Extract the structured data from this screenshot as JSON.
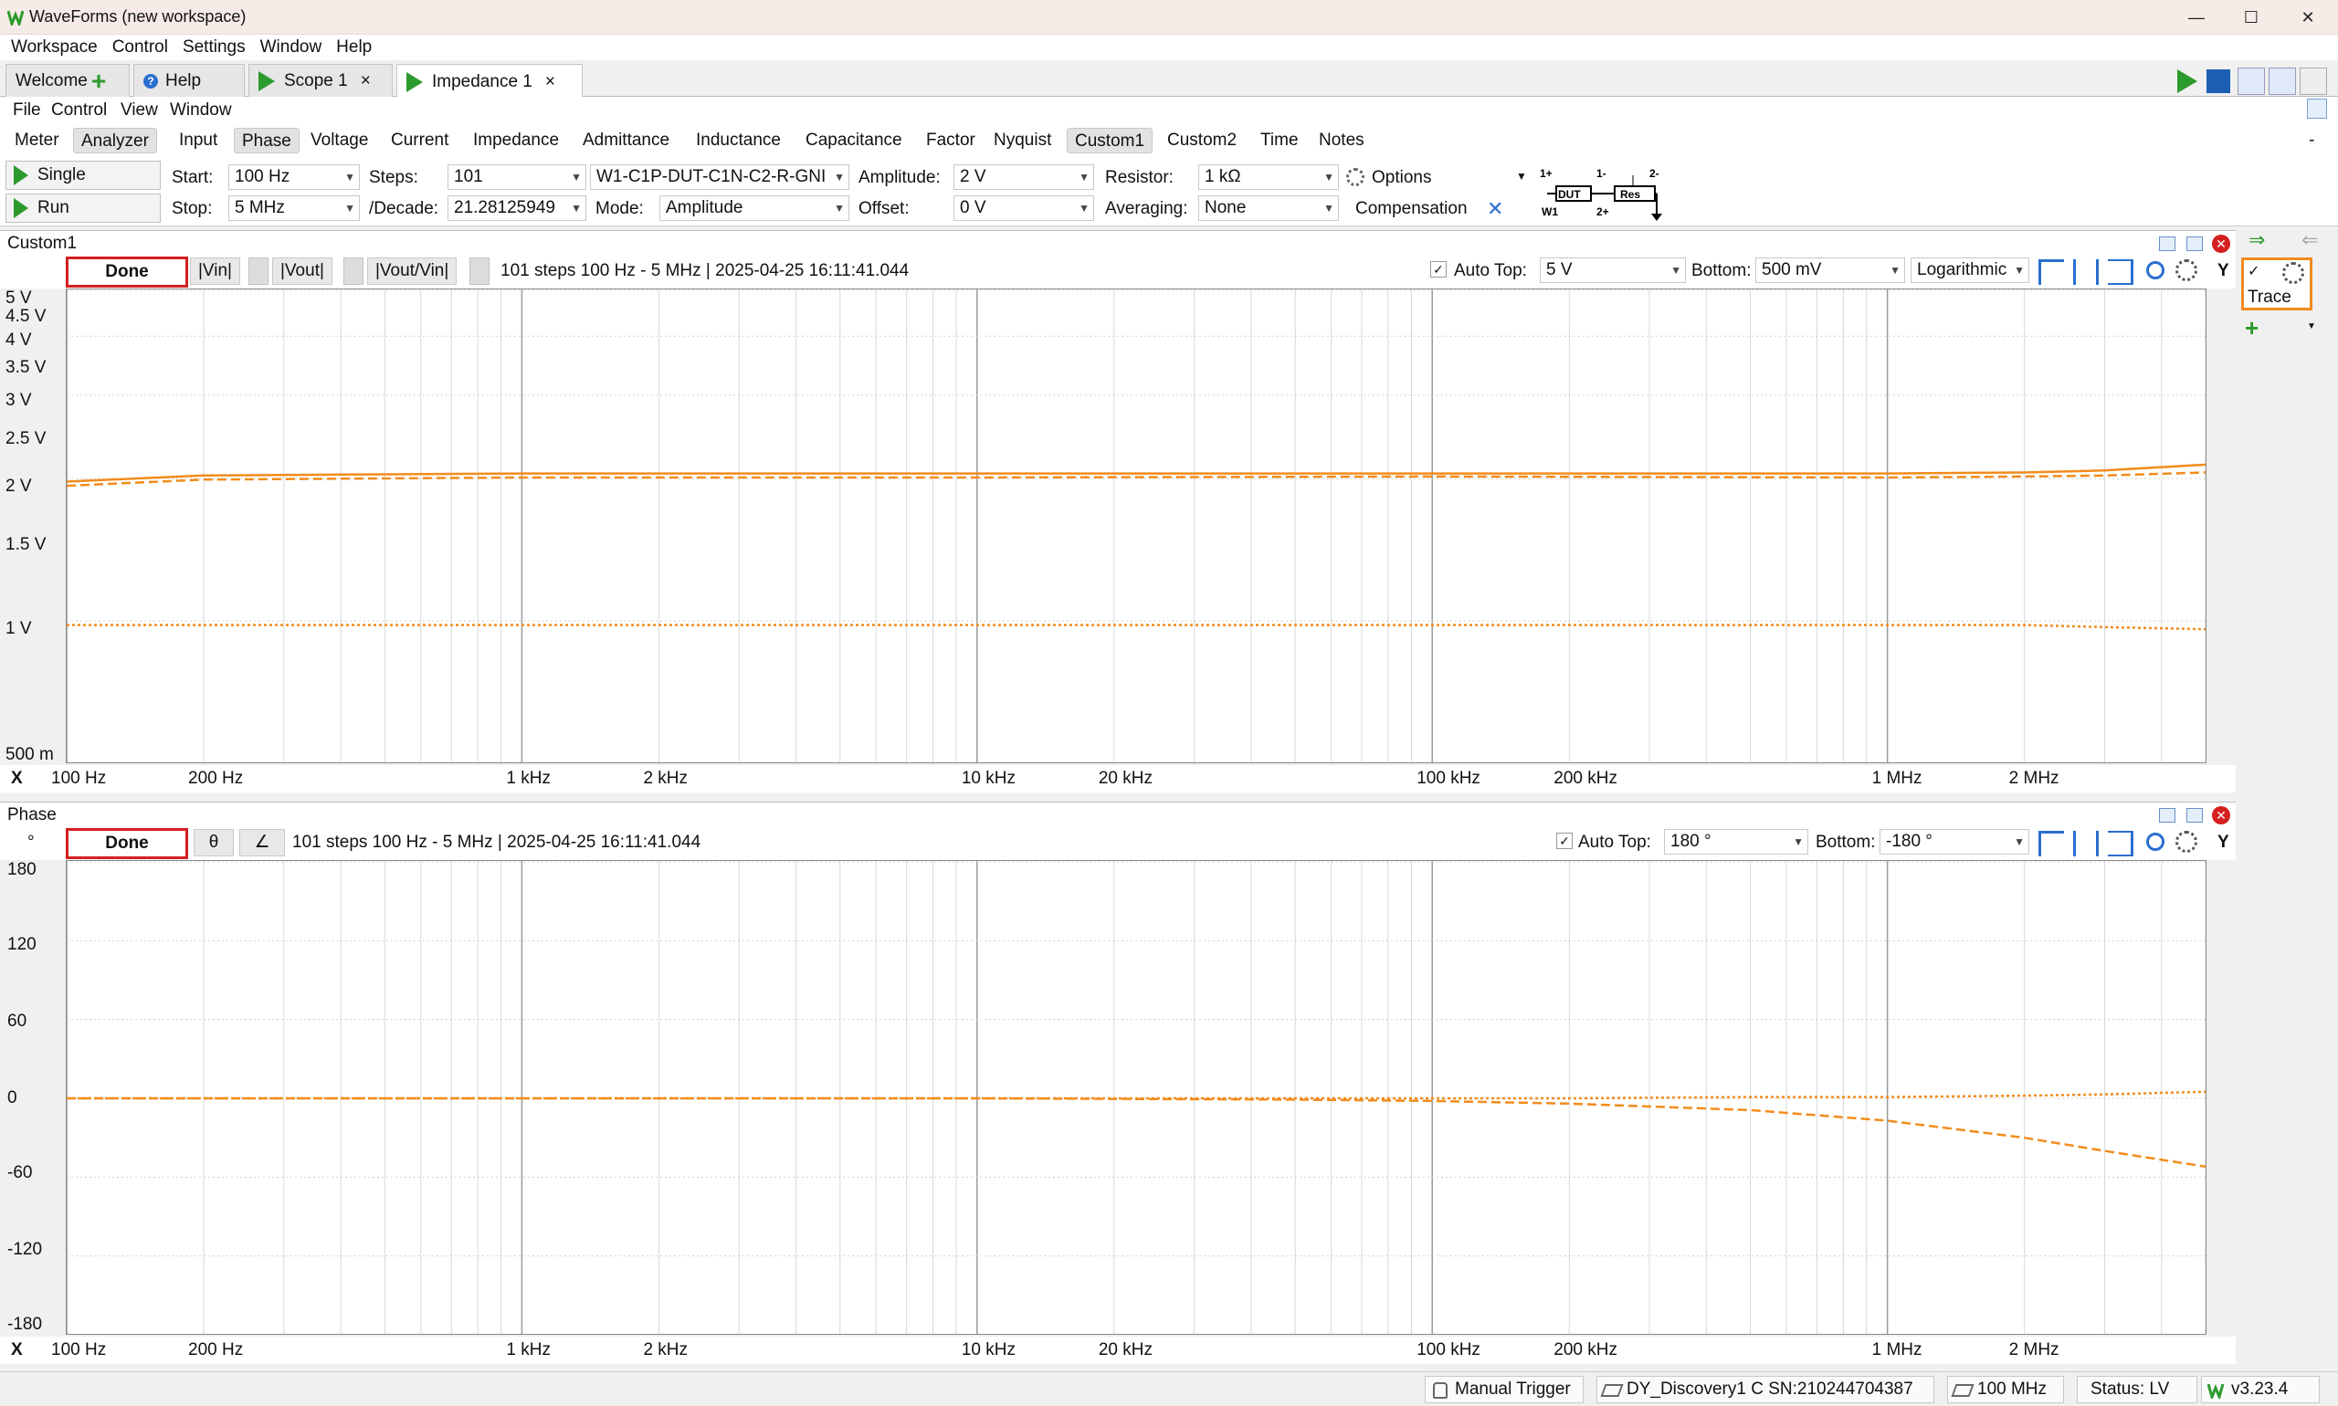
{
  "window": {
    "title": "WaveForms (new workspace)",
    "minimize": "—",
    "maximize": "☐",
    "close": "✕"
  },
  "menubar": [
    "Workspace",
    "Control",
    "Settings",
    "Window",
    "Help"
  ],
  "tabs": {
    "welcome": "Welcome",
    "help": "Help",
    "scope": "Scope 1",
    "impedance": "Impedance 1",
    "close": "×"
  },
  "submenu": [
    "File",
    "Control",
    "View",
    "Window"
  ],
  "viewtabs": [
    "Meter",
    "Analyzer",
    "Input",
    "Phase",
    "Voltage",
    "Current",
    "Impedance",
    "Admittance",
    "Inductance",
    "Capacitance",
    "Factor",
    "Nyquist",
    "Custom1",
    "Custom2",
    "Time",
    "Notes"
  ],
  "viewtabs_right": "-",
  "controls": {
    "single": "Single",
    "run": "Run",
    "start_label": "Start:",
    "start_value": "100 Hz",
    "stop_label": "Stop:",
    "stop_value": "5 MHz",
    "steps_label": "Steps:",
    "steps_value": "101",
    "decade_label": "/Decade:",
    "decade_value": "21.28125949",
    "adapter_value": "W1-C1P-DUT-C1N-C2-R-GNI",
    "mode_label": "Mode:",
    "mode_value": "Amplitude",
    "amplitude_label": "Amplitude:",
    "amplitude_value": "2 V",
    "offset_label": "Offset:",
    "offset_value": "0 V",
    "resistor_label": "Resistor:",
    "resistor_value": "1 kΩ",
    "averaging_label": "Averaging:",
    "averaging_value": "None",
    "options_label": "Options",
    "compensation_label": "Compensation",
    "diagram": {
      "p1": "1+",
      "m1": "1-",
      "m2": "2-",
      "w1": "W1",
      "p2": "2+",
      "dut": "DUT",
      "res": "Res"
    }
  },
  "custom1": {
    "title": "Custom1",
    "done": "Done",
    "vin": "|Vin|",
    "vout": "|Vout|",
    "ratio": "|Vout/Vin|",
    "info": "101 steps 100 Hz - 5 MHz | 2025-04-25 16:11:41.044",
    "autotop_check": "✓",
    "autotop_label": "Auto Top:",
    "top_value": "5 V",
    "bottom_label": "Bottom:",
    "bottom_value": "500 mV",
    "scale_value": "Logarithmic",
    "y_button": "Y",
    "x_button": "X",
    "yticks": [
      "5 V",
      "4.5 V",
      "4 V",
      "3.5 V",
      "3 V",
      "2.5 V",
      "2 V",
      "1.5 V",
      "1 V",
      "500 m"
    ]
  },
  "phase": {
    "title": "Phase",
    "unit": "°",
    "done": "Done",
    "theta": "θ",
    "angle": "∠",
    "info": "101 steps 100 Hz - 5 MHz | 2025-04-25 16:11:41.044",
    "autotop_check": "✓",
    "autotop_label": "Auto Top:",
    "top_value": "180 °",
    "bottom_label": "Bottom:",
    "bottom_value": "-180 °",
    "y_button": "Y",
    "x_button": "X",
    "yticks": [
      "180",
      "120",
      "60",
      "0",
      "-60",
      "-120",
      "-180"
    ]
  },
  "xticks": [
    "100 Hz",
    "200 Hz",
    "1 kHz",
    "2 kHz",
    "10 kHz",
    "20 kHz",
    "100 kHz",
    "200 kHz",
    "1 MHz",
    "2 MHz"
  ],
  "rightpanel": {
    "check": "✓",
    "trace": "Trace",
    "add": "+"
  },
  "status": {
    "trigger": "Manual Trigger",
    "device": "DY_Discovery1 C SN:210244704387",
    "clock": "100 MHz",
    "status": "Status: LV",
    "version": "v3.23.4"
  },
  "colors": {
    "trace": "#f28c1c",
    "done_border": "#d42020",
    "play": "#2c9a2c"
  },
  "chart_data": [
    {
      "type": "line",
      "title": "Custom1",
      "xscale": "log",
      "xlim": [
        100,
        5000000
      ],
      "ylim": [
        0.5,
        5
      ],
      "x": [
        100,
        200,
        1000,
        10000,
        100000,
        1000000,
        2000000,
        3000000,
        5000000
      ],
      "series": [
        {
          "name": "|Vin|",
          "style": "solid",
          "values": [
            1.97,
            2.03,
            2.05,
            2.05,
            2.05,
            2.05,
            2.06,
            2.08,
            2.14
          ]
        },
        {
          "name": "|Vout|",
          "style": "dashed",
          "values": [
            1.93,
            1.99,
            2.01,
            2.01,
            2.02,
            2.01,
            2.02,
            2.03,
            2.06
          ]
        },
        {
          "name": "|Vout/Vin|",
          "style": "dotted",
          "values": [
            0.98,
            0.98,
            0.98,
            0.98,
            0.98,
            0.98,
            0.98,
            0.97,
            0.96
          ]
        }
      ]
    },
    {
      "type": "line",
      "title": "Phase",
      "xscale": "log",
      "xlim": [
        100,
        5000000
      ],
      "ylim": [
        -180,
        180
      ],
      "x": [
        100,
        1000,
        10000,
        50000,
        100000,
        200000,
        500000,
        1000000,
        2000000,
        3000000,
        5000000
      ],
      "series": [
        {
          "name": "θ",
          "style": "dashed",
          "values": [
            0,
            0,
            0,
            -1,
            -2,
            -4,
            -9,
            -17,
            -30,
            -40,
            -52
          ]
        },
        {
          "name": "∠",
          "style": "dotted",
          "values": [
            0,
            0,
            0,
            0,
            0,
            0,
            1,
            1,
            2,
            3,
            5
          ]
        }
      ]
    }
  ]
}
